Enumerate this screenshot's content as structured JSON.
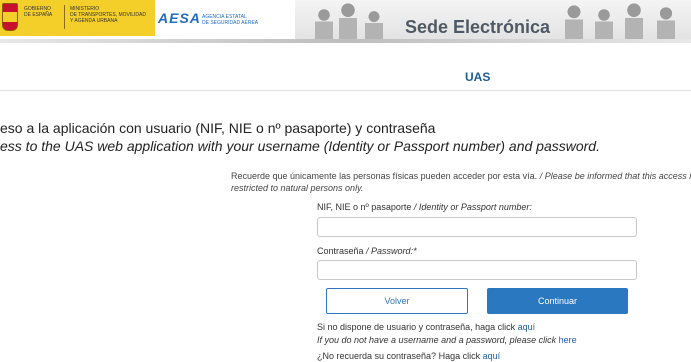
{
  "header": {
    "gov_line1": "GOBIERNO",
    "gov_line2": "DE ESPAÑA",
    "ministry_line1": "MINISTERIO",
    "ministry_line2": "DE TRANSPORTES, MOVILIDAD",
    "ministry_line3": "Y AGENDA URBANA",
    "aesa_logo": "AESA",
    "aesa_sub1": "AGENCIA ESTATAL",
    "aesa_sub2": "DE SEGURIDAD AÉREA",
    "banner_title": "Sede Electrónica"
  },
  "section": {
    "title": "UAS"
  },
  "headings": {
    "spanish": "eso a la aplicación con usuario (NIF, NIE o nº pasaporte) y contraseña",
    "english": "ess to the UAS web application with your username (Identity or Passport number) and password."
  },
  "notice": {
    "spanish": "Recuerde que únicamente las personas físicas pueden acceder por esta vía.",
    "english": "/ Please be informed that this access is restricted to natural persons only."
  },
  "form": {
    "user_label": "NIF, NIE o nº pasaporte",
    "user_label_en": "/ Identity or Passport number:",
    "user_value": "",
    "password_label": "Contraseña",
    "password_label_en": "/ Password:*",
    "password_value": "",
    "back_button": "Volver",
    "continue_button": "Continuar"
  },
  "links": {
    "no_user_es": "Si no dispone de usuario y contraseña, haga click",
    "no_user_es_link": "aquí",
    "no_user_en": "If you do not have a username and a password, please click",
    "no_user_en_link": "here",
    "forgot_es": "¿No recuerda su contraseña? Haga click",
    "forgot_es_link": "aquí"
  },
  "colors": {
    "accent": "#2a78bf",
    "title": "#1d5d93",
    "gov_yellow": "#f4cf2a",
    "aesa_blue": "#1f6cc0"
  }
}
